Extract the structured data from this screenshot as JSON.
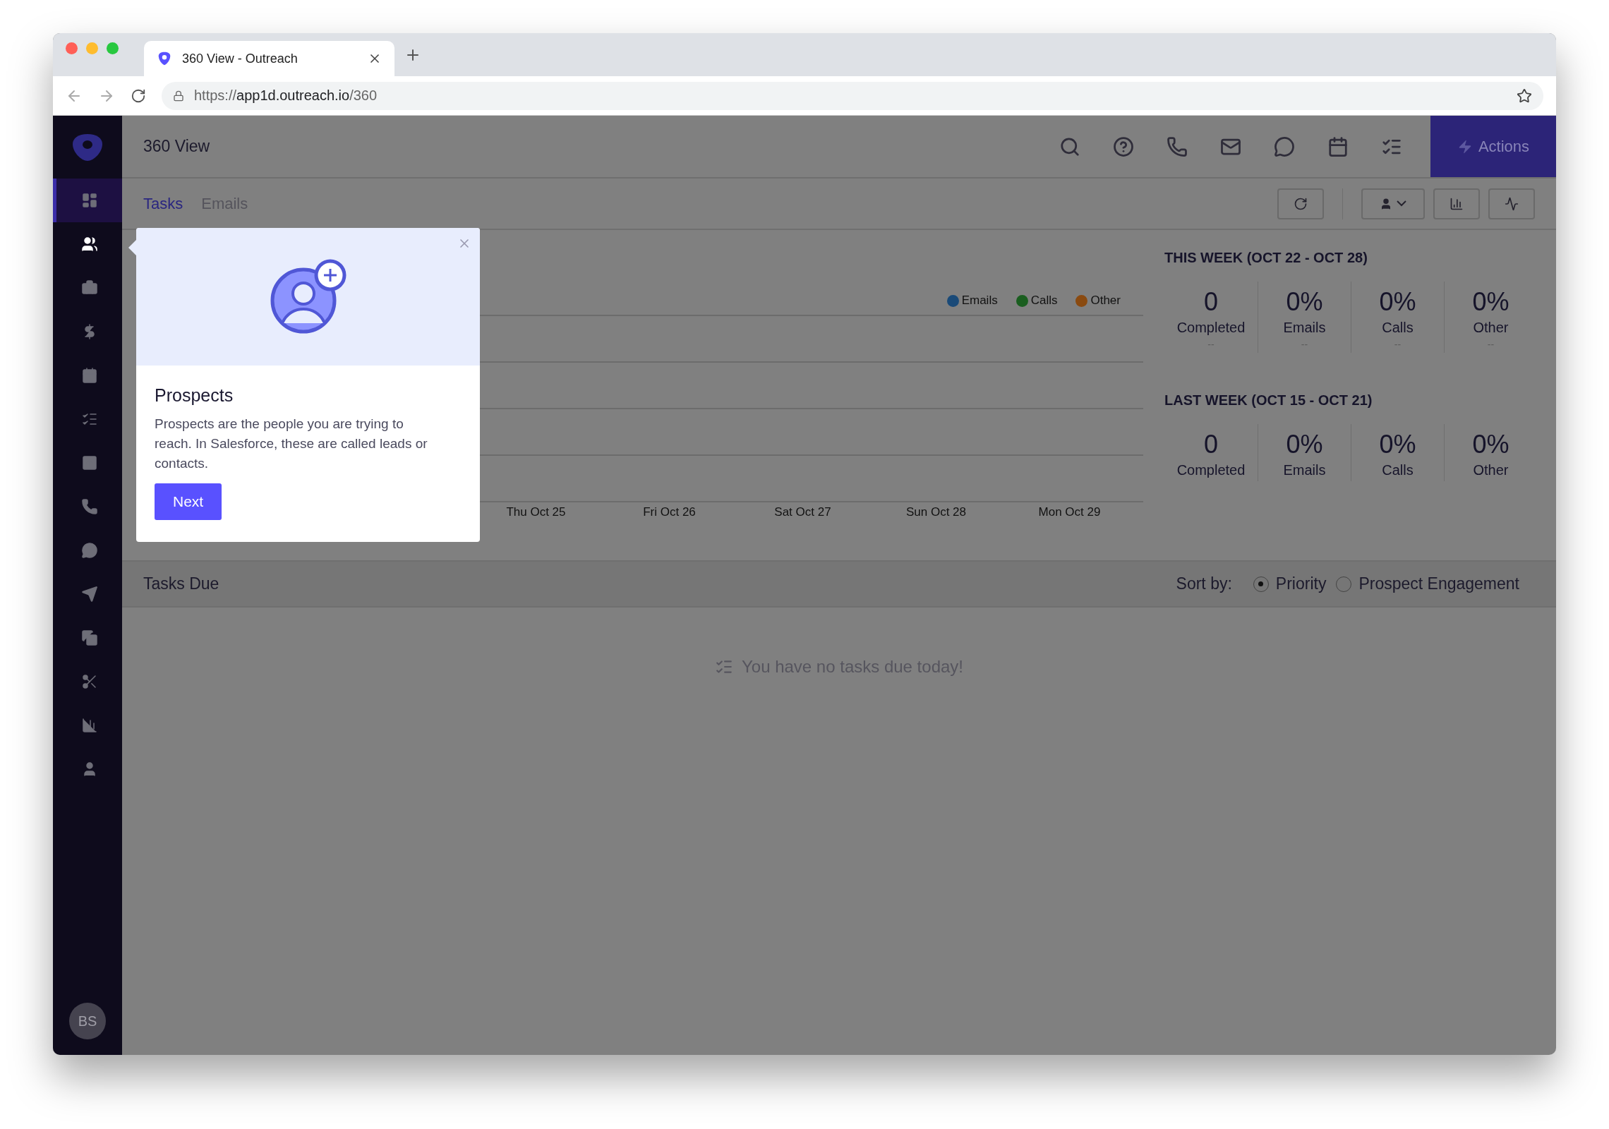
{
  "browser": {
    "tab_title": "360 View - Outreach",
    "url": {
      "scheme": "https://",
      "host": "app1d.outreach.io",
      "path": "/360"
    }
  },
  "sidebar": {
    "items": [
      {
        "selected": true,
        "spotlit": false
      },
      {
        "selected": false,
        "spotlit": true
      },
      {
        "selected": false,
        "spotlit": false
      },
      {
        "selected": false,
        "spotlit": false
      },
      {
        "selected": false,
        "spotlit": false
      },
      {
        "selected": false,
        "spotlit": false
      },
      {
        "selected": false,
        "spotlit": false
      },
      {
        "selected": false,
        "spotlit": false
      },
      {
        "selected": false,
        "spotlit": false
      },
      {
        "selected": false,
        "spotlit": false
      },
      {
        "selected": false,
        "spotlit": false
      },
      {
        "selected": false,
        "spotlit": false
      },
      {
        "selected": false,
        "spotlit": false
      },
      {
        "selected": false,
        "spotlit": false
      }
    ],
    "avatar": "BS"
  },
  "header": {
    "title": "360 View",
    "actions_button": "Actions"
  },
  "tabs": [
    {
      "label": "Tasks",
      "selected": true
    },
    {
      "label": "Emails",
      "selected": false
    }
  ],
  "activity_chart": {
    "legend": [
      {
        "label": "Emails",
        "color": "#1a4a78"
      },
      {
        "label": "Calls",
        "color": "#1a5e1f"
      },
      {
        "label": "Other",
        "color": "#8a4a10"
      }
    ],
    "x_labels": [
      "Thu Oct 25",
      "Fri Oct 26",
      "Sat Oct 27",
      "Sun Oct 28",
      "Mon Oct 29"
    ]
  },
  "weeks": [
    {
      "title": "THIS WEEK (OCT 22 - OCT 28)",
      "stats": [
        {
          "value": "0",
          "label": "Completed",
          "sub": "--"
        },
        {
          "value": "0%",
          "label": "Emails",
          "sub": "--"
        },
        {
          "value": "0%",
          "label": "Calls",
          "sub": "--"
        },
        {
          "value": "0%",
          "label": "Other",
          "sub": "--"
        }
      ]
    },
    {
      "title": "LAST WEEK (OCT 15 - OCT 21)",
      "stats": [
        {
          "value": "0",
          "label": "Completed"
        },
        {
          "value": "0%",
          "label": "Emails"
        },
        {
          "value": "0%",
          "label": "Calls"
        },
        {
          "value": "0%",
          "label": "Other"
        }
      ]
    }
  ],
  "tasks_due": {
    "title": "Tasks Due",
    "sort_label": "Sort by:",
    "sort_options": [
      {
        "label": "Priority",
        "selected": true
      },
      {
        "label": "Prospect Engagement",
        "selected": false
      }
    ],
    "empty_message": "You have no tasks due today!"
  },
  "tour_popup": {
    "title": "Prospects",
    "body": "Prospects are the people you are trying to reach. In Salesforce, these are called leads or contacts.",
    "button": "Next"
  }
}
